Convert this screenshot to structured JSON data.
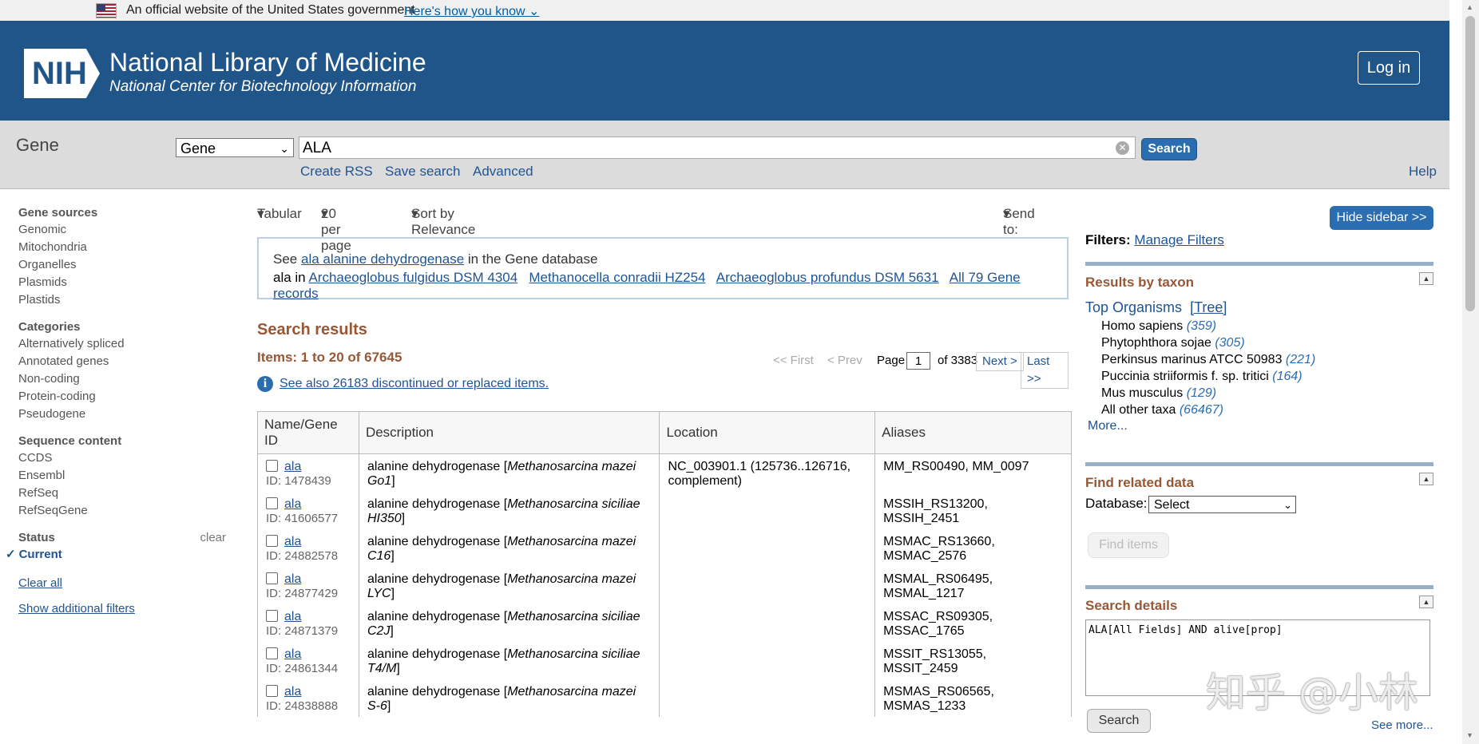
{
  "banner": {
    "text": "An official website of the United States government",
    "link": "Here's how you know"
  },
  "header": {
    "title": "National Library of Medicine",
    "subtitle": "National Center for Biotechnology Information",
    "logo": "NIH",
    "login": "Log in"
  },
  "search": {
    "db_label": "Gene",
    "db_value": "Gene",
    "term": "ALA",
    "button": "Search",
    "links": [
      "Create RSS",
      "Save search",
      "Advanced"
    ],
    "help": "Help"
  },
  "leftnav": {
    "groups": [
      {
        "title": "Gene sources",
        "items": [
          "Genomic",
          "Mitochondria",
          "Organelles",
          "Plasmids",
          "Plastids"
        ]
      },
      {
        "title": "Categories",
        "items": [
          "Alternatively spliced",
          "Annotated genes",
          "Non-coding",
          "Protein-coding",
          "Pseudogene"
        ]
      },
      {
        "title": "Sequence content",
        "items": [
          "CCDS",
          "Ensembl",
          "RefSeq",
          "RefSeqGene"
        ]
      }
    ],
    "status_title": "Status",
    "status_clear": "clear",
    "status_current": "Current",
    "clear_all": "Clear all",
    "show_filters": "Show additional filters"
  },
  "toolbar": {
    "format": "Tabular",
    "perpage": "20 per page",
    "sort": "Sort by Relevance",
    "sendto": "Send to:"
  },
  "promo": {
    "see": "See",
    "see_link": "ala alanine dehydrogenase",
    "see_rest": "in the Gene database",
    "ala_in": "ala in",
    "links": [
      "Archaeoglobus fulgidus DSM 4304",
      "Methanocella conradii HZ254",
      "Archaeoglobus profundus DSM 5631",
      "All 79 Gene records"
    ]
  },
  "results": {
    "title": "Search results",
    "items": "Items: 1 to 20 of 67645",
    "info": "See also 26183 discontinued or replaced items."
  },
  "pager": {
    "first": "<< First",
    "prev": "< Prev",
    "page_label": "Page",
    "page": "1",
    "of": "of 3383",
    "next": "Next >",
    "last": "Last >>"
  },
  "table": {
    "headers": [
      "Name/Gene ID",
      "Description",
      "Location",
      "Aliases"
    ],
    "rows": [
      {
        "name": "ala",
        "id": "ID: 1478439",
        "desc": "alanine dehydrogenase [",
        "org1": "Methanosarcina mazei",
        "org2": "Go1",
        "location1": "NC_003901.1 (125736..126716,",
        "location2": "complement)",
        "alias1": "MM_RS00490, MM_0097",
        "alias2": ""
      },
      {
        "name": "ala",
        "id": "ID: 41606577",
        "desc": "alanine dehydrogenase [",
        "org1": "Methanosarcina siciliae",
        "org2": "HI350",
        "location1": "",
        "location2": "",
        "alias1": "MSSIH_RS13200,",
        "alias2": "MSSIH_2451"
      },
      {
        "name": "ala",
        "id": "ID: 24882578",
        "desc": "alanine dehydrogenase [",
        "org1": "Methanosarcina mazei",
        "org2": "C16",
        "location1": "",
        "location2": "",
        "alias1": "MSMAC_RS13660,",
        "alias2": "MSMAC_2576"
      },
      {
        "name": "ala",
        "id": "ID: 24877429",
        "desc": "alanine dehydrogenase [",
        "org1": "Methanosarcina mazei",
        "org2": "LYC",
        "location1": "",
        "location2": "",
        "alias1": "MSMAL_RS06495,",
        "alias2": "MSMAL_1217"
      },
      {
        "name": "ala",
        "id": "ID: 24871379",
        "desc": "alanine dehydrogenase [",
        "org1": "Methanosarcina siciliae",
        "org2": "C2J",
        "location1": "",
        "location2": "",
        "alias1": "MSSAC_RS09305,",
        "alias2": "MSSAC_1765"
      },
      {
        "name": "ala",
        "id": "ID: 24861344",
        "desc": "alanine dehydrogenase [",
        "org1": "Methanosarcina siciliae",
        "org2": "T4/M",
        "location1": "",
        "location2": "",
        "alias1": "MSSIT_RS13055,",
        "alias2": "MSSIT_2459"
      },
      {
        "name": "ala",
        "id": "ID: 24838888",
        "desc": "alanine dehydrogenase [",
        "org1": "Methanosarcina mazei",
        "org2": "S-6",
        "location1": "",
        "location2": "",
        "alias1": "MSMAS_RS06565,",
        "alias2": "MSMAS_1233"
      }
    ]
  },
  "sidebar": {
    "hide": "Hide sidebar >>",
    "filters_label": "Filters:",
    "manage": "Manage Filters",
    "taxon_title": "Results by taxon",
    "top_org": "Top Organisms",
    "tree": "[Tree]",
    "taxa": [
      {
        "name": "Homo sapiens",
        "count": "(359)"
      },
      {
        "name": "Phytophthora sojae",
        "count": "(305)"
      },
      {
        "name": "Perkinsus marinus ATCC 50983",
        "count": "(221)"
      },
      {
        "name": "Puccinia striiformis f. sp. tritici",
        "count": "(164)"
      },
      {
        "name": "Mus musculus",
        "count": "(129)"
      },
      {
        "name": "All other taxa",
        "count": "(66467)"
      }
    ],
    "more": "More...",
    "related_title": "Find related data",
    "db_label": "Database:",
    "db_value": "Select",
    "find_items": "Find items",
    "details_title": "Search details",
    "query": "ALA[All Fields] AND alive[prop]",
    "details_search": "Search",
    "see_more": "See more..."
  },
  "watermark": "知乎 @小林"
}
